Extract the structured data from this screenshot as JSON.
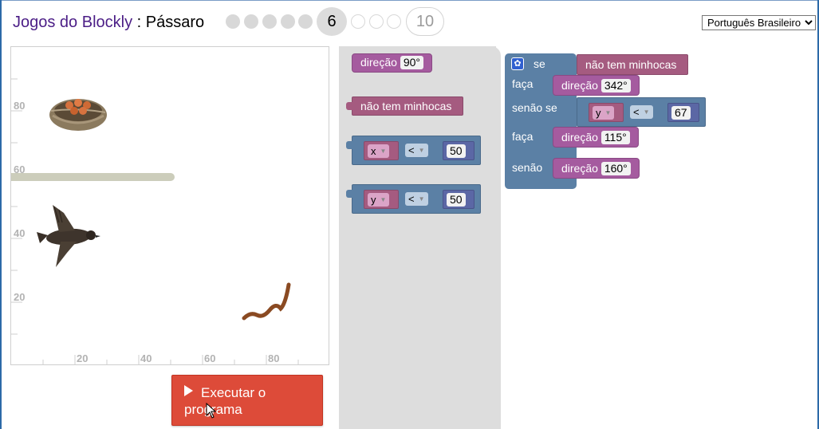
{
  "header": {
    "app_name": "Jogos do Blockly",
    "separator": " : ",
    "game_name": "Pássaro",
    "current_level": "6",
    "last_level": "10"
  },
  "language": {
    "selected": "Português Brasileiro"
  },
  "map": {
    "y_ticks": [
      "80",
      "60",
      "40",
      "20"
    ],
    "x_ticks": [
      "20",
      "40",
      "60",
      "80"
    ]
  },
  "run_button": {
    "line1": "Executar o",
    "line2": "programa"
  },
  "toolbox": {
    "heading_block": {
      "label": "direção",
      "value": "90°"
    },
    "no_worm_block": {
      "label": "não tem minhocas"
    },
    "x_compare": {
      "var": "x",
      "op": "<",
      "value": "50"
    },
    "y_compare": {
      "var": "y",
      "op": "<",
      "value": "50"
    }
  },
  "program": {
    "if_label": "se",
    "if_condition": "não tem minhocas",
    "do_label": "faça",
    "do1": {
      "label": "direção",
      "value": "342°"
    },
    "elseif_label": "senão se",
    "elseif_condition": {
      "var": "y",
      "op": "<",
      "value": "67"
    },
    "do2": {
      "label": "direção",
      "value": "115°"
    },
    "else_label": "senão",
    "do3": {
      "label": "direção",
      "value": "160°"
    }
  },
  "colors": {
    "accent_title": "#4b1d86",
    "run_button": "#dd4b39",
    "heading_block": "#a55b9f",
    "condition_block": "#a55b80",
    "logic_block": "#5b80a5",
    "toolbox_bg": "#dddddd"
  }
}
